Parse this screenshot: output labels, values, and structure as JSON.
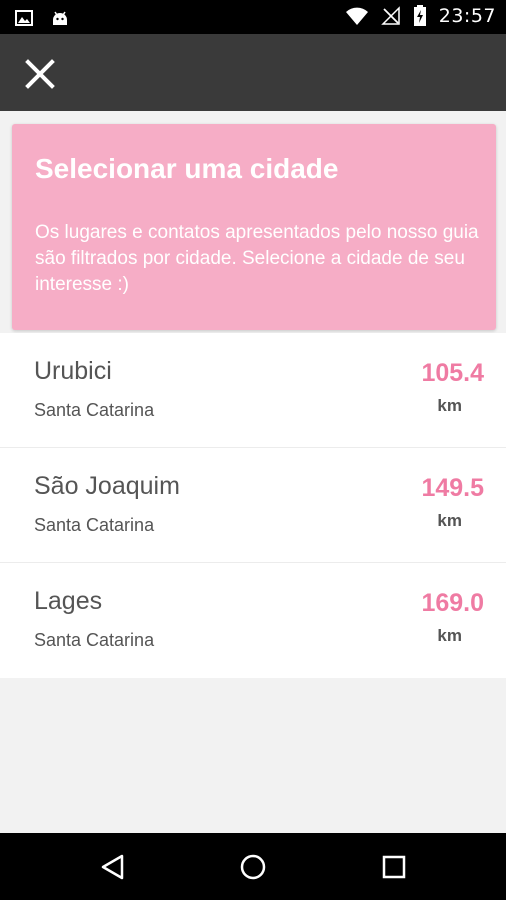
{
  "status_bar": {
    "time": "23:57",
    "left_icons": [
      "image-icon",
      "android-icon"
    ],
    "right_icons": [
      "wifi-icon",
      "no-signal-icon",
      "battery-charging-icon"
    ]
  },
  "toolbar": {
    "close_icon": "close-icon"
  },
  "intro": {
    "title": "Selecionar uma cidade",
    "text": "Os lugares e contatos apresentados pelo nosso guia são filtrados por cidade. Selecione a cidade de seu interesse :)"
  },
  "cities": [
    {
      "name": "Urubici",
      "state": "Santa Catarina",
      "distance": "105.4",
      "unit": "km"
    },
    {
      "name": "São Joaquim",
      "state": "Santa Catarina",
      "distance": "149.5",
      "unit": "km"
    },
    {
      "name": "Lages",
      "state": "Santa Catarina",
      "distance": "169.0",
      "unit": "km"
    }
  ],
  "colors": {
    "accent": "#ef7ba3",
    "card": "#f6adc6",
    "toolbar": "#3a3a3a"
  },
  "nav_bar": {
    "buttons": [
      "back-icon",
      "home-icon",
      "recents-icon"
    ]
  }
}
